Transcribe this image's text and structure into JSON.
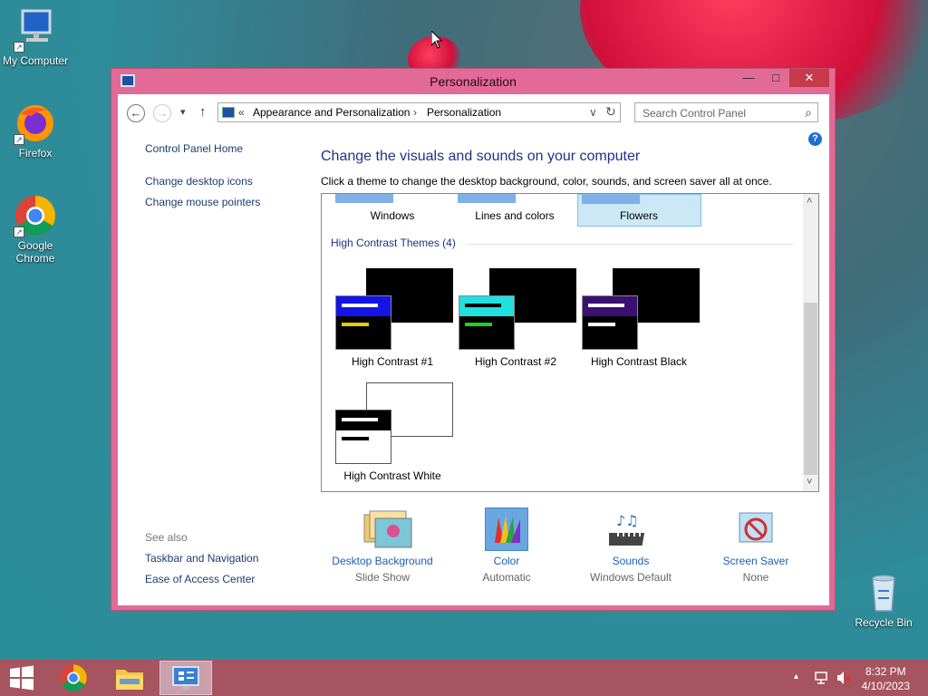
{
  "desktop": {
    "icons": [
      {
        "label": "My Computer",
        "icon": "computer-icon"
      },
      {
        "label": "Firefox",
        "icon": "firefox-icon"
      },
      {
        "label": "Google Chrome",
        "icon": "chrome-icon"
      },
      {
        "label": "Recycle Bin",
        "icon": "recycle-bin-icon"
      }
    ]
  },
  "window": {
    "title": "Personalization",
    "controls": {
      "minimize": "—",
      "maximize": "□",
      "close": "✕"
    }
  },
  "address_bar": {
    "back": "←",
    "forward": "→",
    "dropdown": "▾",
    "up": "↑",
    "overflow": "«",
    "crumbs": [
      "Appearance and Personalization",
      "Personalization"
    ],
    "separator": "›",
    "refresh": "↻",
    "chevron": "∨"
  },
  "search": {
    "placeholder": "Search Control Panel",
    "icon": "⌕"
  },
  "help": {
    "label": "?"
  },
  "sidebar": {
    "home": "Control Panel Home",
    "links": [
      "Change desktop icons",
      "Change mouse pointers"
    ],
    "see_also_title": "See also",
    "see_also": [
      "Taskbar and Navigation",
      "Ease of Access Center"
    ]
  },
  "main": {
    "heading": "Change the visuals and sounds on your computer",
    "subheading": "Click a theme to change the desktop background, color, sounds, and screen saver all at once.",
    "top_themes": [
      "Windows",
      "Lines and colors",
      "Flowers"
    ],
    "selected_theme": "Flowers",
    "group_title": "High Contrast Themes (4)",
    "hc_themes": [
      {
        "name": "High Contrast #1",
        "front_header": "#1414e6",
        "bar1": "#ffffff",
        "bar2": "#e0d000"
      },
      {
        "name": "High Contrast #2",
        "front_header": "#20e0e0",
        "bar1": "#000000",
        "bar2": "#20d020"
      },
      {
        "name": "High Contrast Black",
        "front_header": "#3a1070",
        "bar1": "#ffffff",
        "bar2": "#ffffff"
      },
      {
        "name": "High Contrast White",
        "front_header": "#000000",
        "bar1": "#ffffff",
        "bar2": "#000000"
      }
    ],
    "scroll_arrows": {
      "up": "˄",
      "down": "˅"
    }
  },
  "bottom": [
    {
      "label": "Desktop Background",
      "value": "Slide Show",
      "icon": "desktop-background-icon"
    },
    {
      "label": "Color",
      "value": "Automatic",
      "icon": "color-icon"
    },
    {
      "label": "Sounds",
      "value": "Windows Default",
      "icon": "sounds-icon"
    },
    {
      "label": "Screen Saver",
      "value": "None",
      "icon": "screen-saver-icon"
    }
  ],
  "taskbar": {
    "time": "8:32 PM",
    "date": "4/10/2023",
    "tray_arrow": "▴",
    "network": "network-icon",
    "volume": "volume-muted-icon"
  },
  "colors": {
    "window_frame": "#e26a96",
    "taskbar": "#a6545f",
    "link": "#1a5fb4",
    "heading": "#1e3287",
    "close": "#c73a4a"
  }
}
